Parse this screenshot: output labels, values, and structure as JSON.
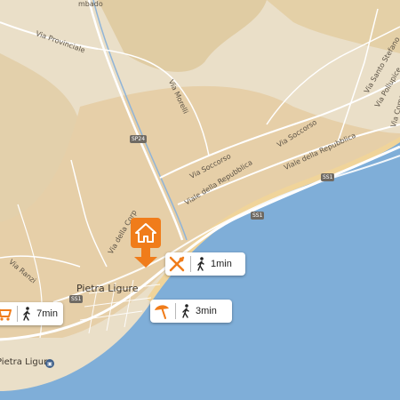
{
  "map": {
    "colors": {
      "land": "#eadfc8",
      "urban": "#e6cfa8",
      "hills": "#dcc393",
      "sea": "#7faed8",
      "accent": "#f07c1a",
      "road": "#ffffff"
    },
    "streets": {
      "via_provinciale": "Via Provinciale",
      "via_morelli": "Via Morelli",
      "via_santa_stefano": "Via Santo Stefano",
      "via_pollupice": "Via Pollupice",
      "via_como": "Via Como",
      "via_soccorso_1": "Via Soccorso",
      "via_soccorso_2": "Via Soccorso",
      "viale_repubblica_1": "Viale della Repubblica",
      "viale_repubblica_2": "Viale della Repubblica",
      "via_della_corp": "Via della Corp",
      "via_ranzi": "Via Ranzi",
      "top_fragment": "mbado"
    },
    "road_shields": {
      "sp24": "SP24",
      "ss1_a": "SS1",
      "ss1_b": "SS1",
      "ss1_c": "SS1"
    },
    "towns": {
      "pietra_ligure": "Pietra Ligure",
      "station": "Pietra Ligure"
    },
    "home_marker": {
      "icon": "home-icon"
    },
    "cards": [
      {
        "poi_icon": "restaurant-icon",
        "walk_icon": "walking-icon",
        "time": "1min"
      },
      {
        "poi_icon": "beach-umbrella-icon",
        "walk_icon": "walking-icon",
        "time": "3min"
      },
      {
        "poi_icon": "shopping-cart-icon",
        "walk_icon": "walking-icon",
        "time": "7min"
      }
    ]
  }
}
